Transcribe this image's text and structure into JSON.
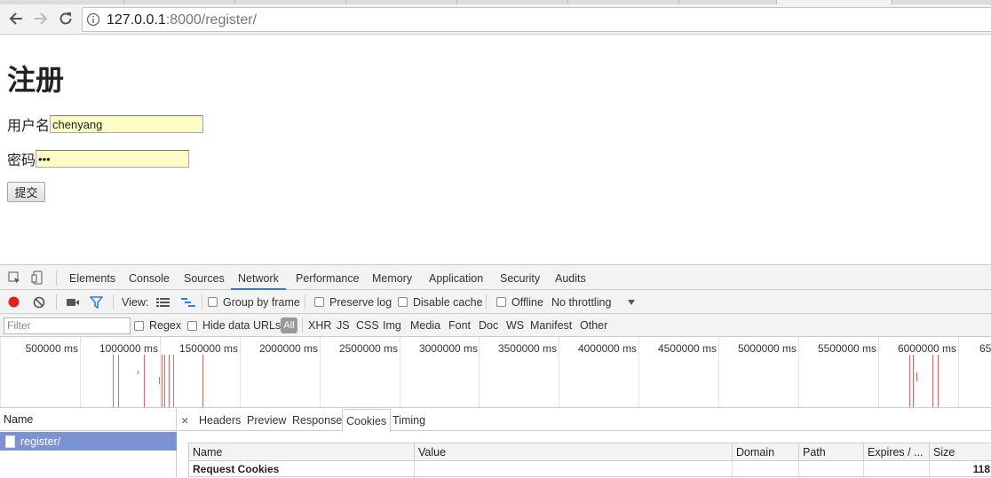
{
  "browser": {
    "url_host": "127.0.0.1",
    "url_path": ":8000/register/"
  },
  "page": {
    "title": "注册",
    "username_label": "用户名",
    "username_value": "chenyang",
    "password_label": "密码",
    "password_value": "•••",
    "submit_label": "提交"
  },
  "devtools": {
    "tabs": [
      "Elements",
      "Console",
      "Sources",
      "Network",
      "Performance",
      "Memory",
      "Application",
      "Security",
      "Audits"
    ],
    "active_tab": "Network",
    "toolbar": {
      "view_label": "View:",
      "group_by_frame": "Group by frame",
      "preserve_log": "Preserve log",
      "disable_cache": "Disable cache",
      "offline": "Offline",
      "throttling": "No throttling"
    },
    "filter": {
      "placeholder": "Filter",
      "regex": "Regex",
      "hide_data_urls": "Hide data URLs",
      "all": "All",
      "types": [
        "XHR",
        "JS",
        "CSS",
        "Img",
        "Media",
        "Font",
        "Doc",
        "WS",
        "Manifest",
        "Other"
      ]
    },
    "timeline_ticks": [
      "500000 ms",
      "1000000 ms",
      "1500000 ms",
      "2000000 ms",
      "2500000 ms",
      "3000000 ms",
      "3500000 ms",
      "4000000 ms",
      "4500000 ms",
      "5000000 ms",
      "5500000 ms",
      "6000000 ms",
      "65"
    ],
    "requests": {
      "header": "Name",
      "items": [
        "register/"
      ]
    },
    "detail_tabs": [
      "Headers",
      "Preview",
      "Response",
      "Cookies",
      "Timing"
    ],
    "active_detail_tab": "Cookies",
    "close_glyph": "×",
    "cookie_table": {
      "columns": [
        "Name",
        "Value",
        "Domain",
        "Path",
        "Expires / ...",
        "Size"
      ],
      "row_group": "Request Cookies",
      "row_size": "118"
    }
  }
}
